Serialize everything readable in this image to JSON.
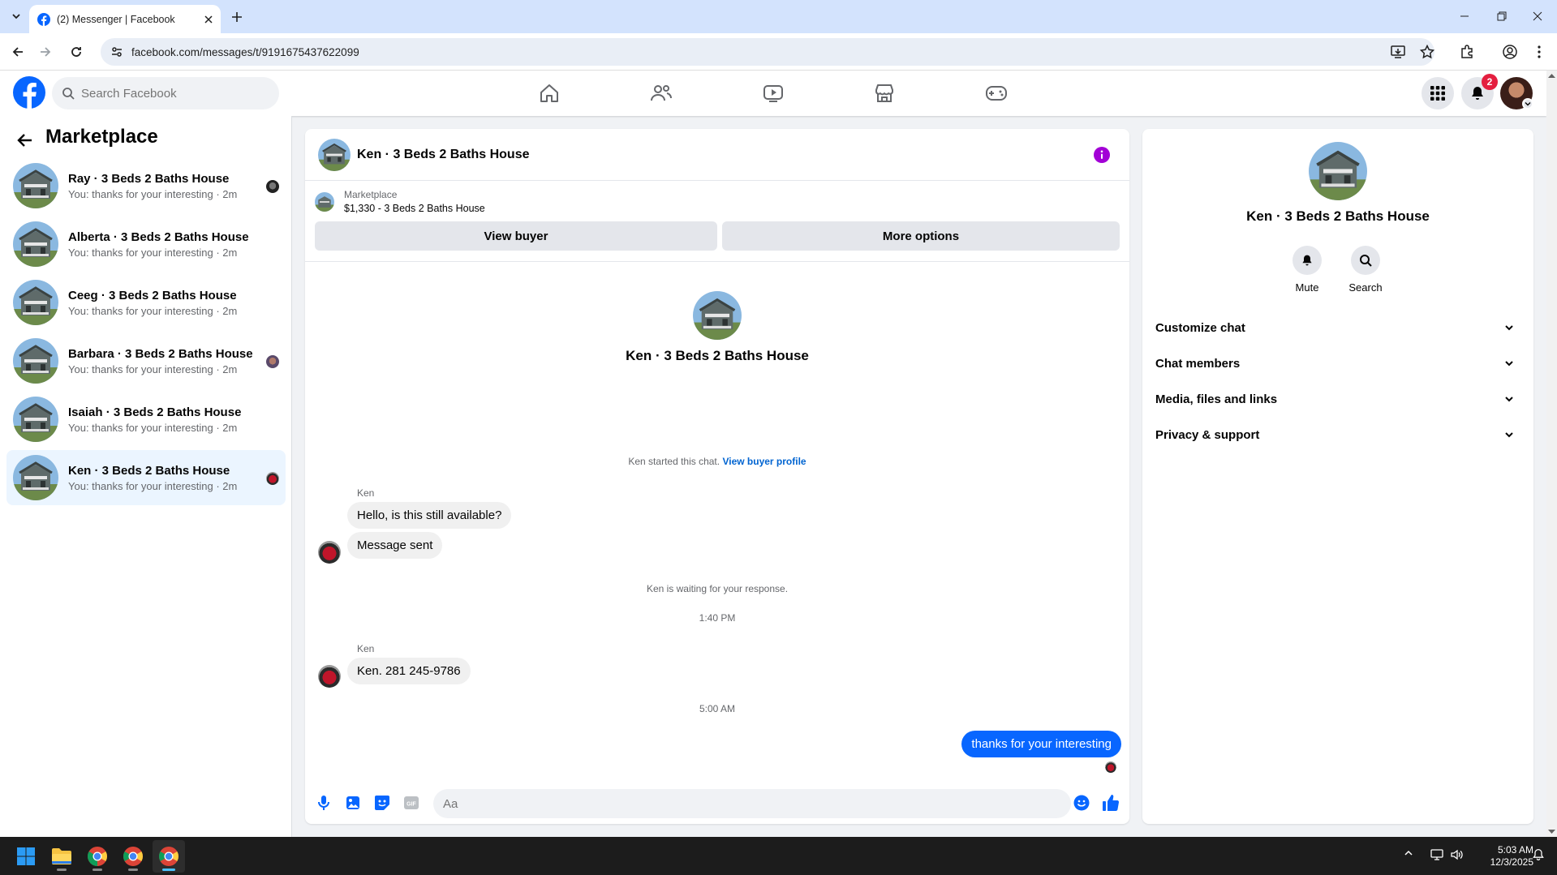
{
  "browser": {
    "tab_title": "(2) Messenger | Facebook",
    "url": "facebook.com/messages/t/9191675437622099"
  },
  "facebook": {
    "search_placeholder": "Search Facebook",
    "notification_count": "2",
    "brand_color": "#0866ff"
  },
  "left_panel": {
    "title": "Marketplace",
    "conversations": [
      {
        "name": "Ray · 3 Beds 2 Baths House",
        "preview": "You: thanks for your interesting · 2m"
      },
      {
        "name": "Alberta · 3 Beds 2 Baths House",
        "preview": "You: thanks for your interesting · 2m"
      },
      {
        "name": "Ceeg · 3 Beds 2 Baths House",
        "preview": "You: thanks for your interesting · 2m"
      },
      {
        "name": "Barbara · 3 Beds 2 Baths House",
        "preview": "You: thanks for your interesting · 2m"
      },
      {
        "name": "Isaiah · 3 Beds 2 Baths House",
        "preview": "You: thanks for your interesting · 2m"
      },
      {
        "name": "Ken · 3 Beds 2 Baths House",
        "preview": "You: thanks for your interesting · 2m"
      }
    ]
  },
  "chat": {
    "title": "Ken · 3 Beds 2 Baths House",
    "marketplace_label": "Marketplace",
    "listing": "$1,330 - 3 Beds 2 Baths House",
    "view_buyer_label": "View buyer",
    "more_options_label": "More options",
    "intro_name": "Ken · 3 Beds 2 Baths House",
    "started_text": "Ken started this chat.",
    "view_buyer_profile": "View buyer profile",
    "sender_1": "Ken",
    "msg_1": "Hello, is this still available?",
    "msg_2": "Message sent",
    "waiting_text": "Ken is waiting for your response.",
    "time_1": "1:40 PM",
    "sender_2": "Ken",
    "msg_3": "Ken.  281 245-9786",
    "time_2": "5:00 AM",
    "msg_mine": "thanks for your interesting",
    "input_placeholder": "Aa"
  },
  "right_panel": {
    "name": "Ken · 3 Beds 2 Baths House",
    "mute_label": "Mute",
    "search_label": "Search",
    "sections": [
      "Customize chat",
      "Chat members",
      "Media, files and links",
      "Privacy & support"
    ]
  },
  "taskbar": {
    "time": "5:03 AM",
    "date": "12/3/2025"
  }
}
